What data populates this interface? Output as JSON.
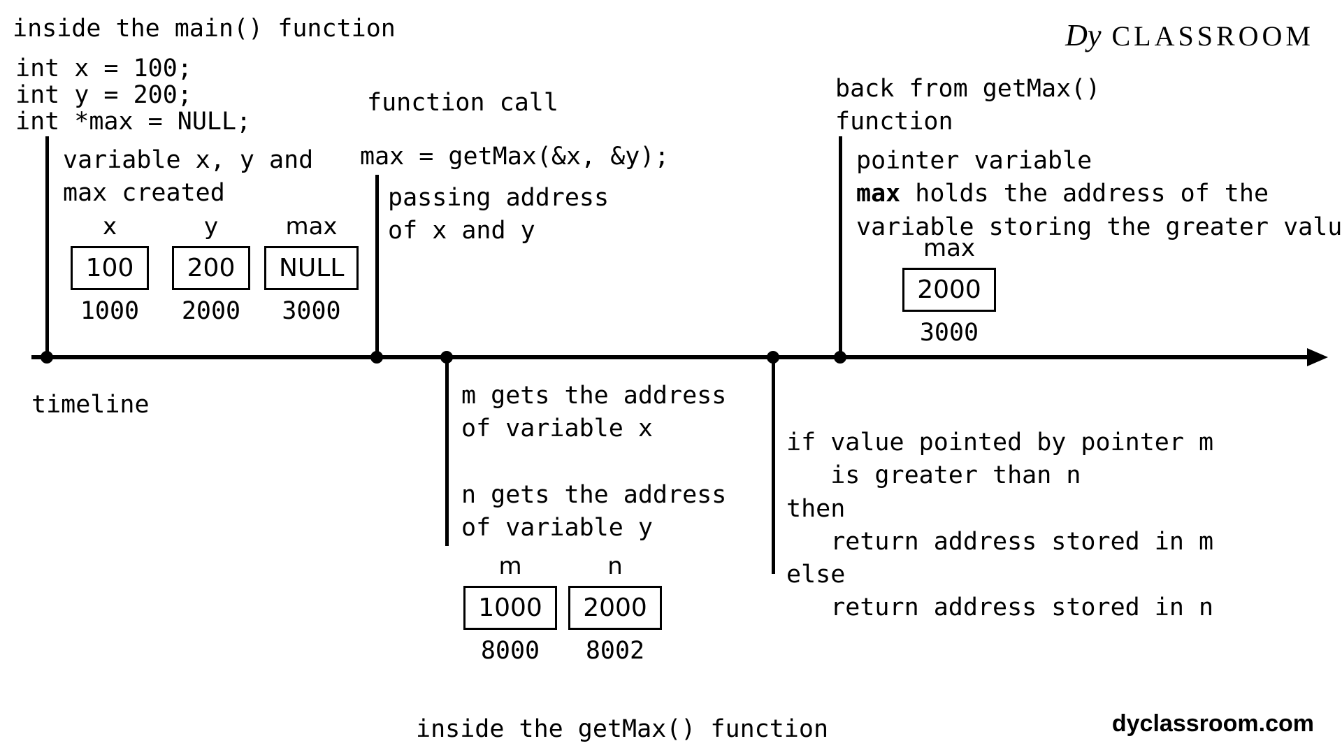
{
  "header": {
    "title": "inside the main() function",
    "logo_prefix": "Dy",
    "logo_text": " CLASSROOM"
  },
  "code": {
    "line1": "int x = 100;",
    "line2": "int y = 200;",
    "line3": "int *max = NULL;"
  },
  "stage1": {
    "caption": "variable x, y and\nmax created",
    "vars": [
      {
        "name": "x",
        "value": "100",
        "addr": "1000"
      },
      {
        "name": "y",
        "value": "200",
        "addr": "2000"
      },
      {
        "name": "max",
        "value": "NULL",
        "addr": "3000"
      }
    ]
  },
  "stage2": {
    "title": "function call",
    "call": "max = getMax(&x, &y);",
    "caption_top": "passing address\nof x and y",
    "caption_bottom": "m gets the address\nof variable x\n\nn gets the address\nof variable y",
    "vars": [
      {
        "name": "m",
        "value": "1000",
        "addr": "8000"
      },
      {
        "name": "n",
        "value": "2000",
        "addr": "8002"
      }
    ]
  },
  "stage3": {
    "logic": "if value pointed by pointer m\n   is greater than n\nthen\n   return address stored in m\nelse\n   return address stored in n"
  },
  "stage4": {
    "title": "back from getMax()\nfunction",
    "caption_pre": "pointer variable\n",
    "caption_bold": "max",
    "caption_post": " holds the address of the\nvariable storing the greater value",
    "var": {
      "name": "max",
      "value": "2000",
      "addr": "3000"
    }
  },
  "labels": {
    "timeline": "timeline",
    "bottom_section": "inside the getMax() function"
  },
  "footer": {
    "url": "dyclassroom.com"
  }
}
